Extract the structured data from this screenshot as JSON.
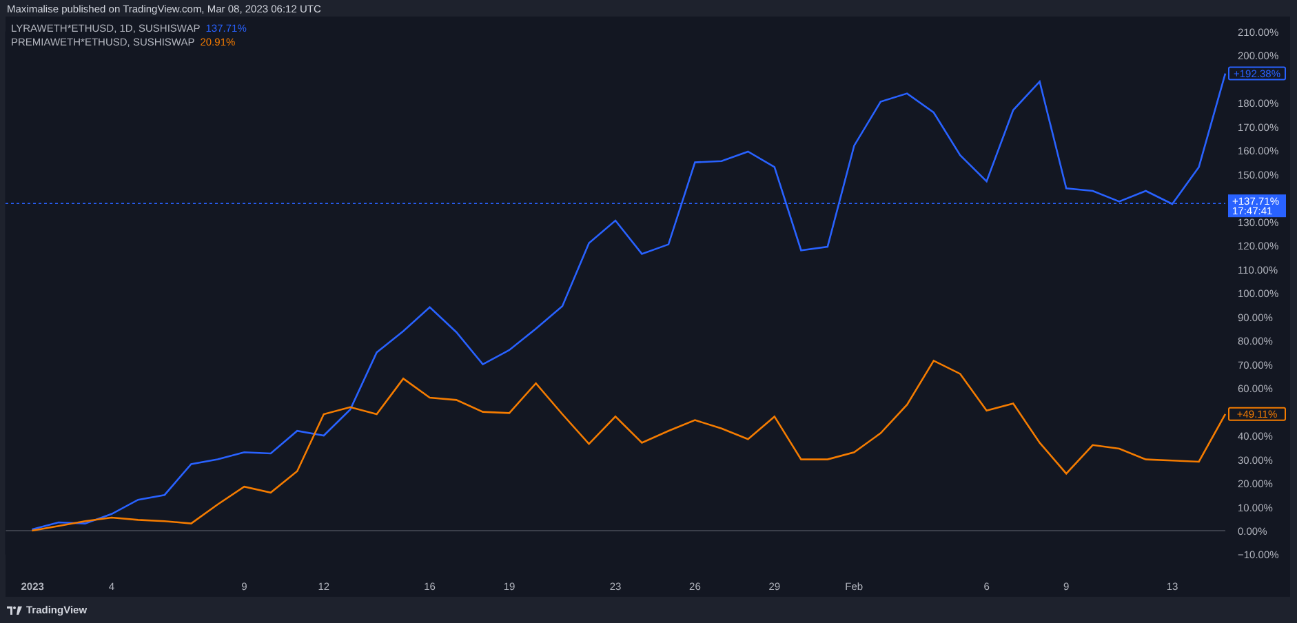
{
  "header": {
    "text": "Maximalise published on TradingView.com, Mar 08, 2023 06:12 UTC"
  },
  "chart": {
    "legend": [
      {
        "value": "137.71%"
      },
      {
        "value": "20.91%"
      }
    ],
    "chart_data": {
      "type": "line",
      "x": [
        "2023-01-01",
        "2023-01-02",
        "2023-01-03",
        "2023-01-04",
        "2023-01-05",
        "2023-01-06",
        "2023-01-07",
        "2023-01-08",
        "2023-01-09",
        "2023-01-10",
        "2023-01-11",
        "2023-01-12",
        "2023-01-13",
        "2023-01-14",
        "2023-01-15",
        "2023-01-16",
        "2023-01-17",
        "2023-01-18",
        "2023-01-19",
        "2023-01-20",
        "2023-01-21",
        "2023-01-22",
        "2023-01-23",
        "2023-01-24",
        "2023-01-25",
        "2023-01-26",
        "2023-01-27",
        "2023-01-28",
        "2023-01-29",
        "2023-01-30",
        "2023-01-31",
        "2023-02-01",
        "2023-02-02",
        "2023-02-03",
        "2023-02-04",
        "2023-02-05",
        "2023-02-06",
        "2023-02-07",
        "2023-02-08",
        "2023-02-09",
        "2023-02-10",
        "2023-02-11",
        "2023-02-12",
        "2023-02-13",
        "2023-02-14",
        "2023-02-15"
      ],
      "series": [
        {
          "name": "LYRAWETH*ETHUSD, 1D, SUSHISWAP",
          "color": "#2962ff",
          "values": [
            0.5,
            3.5,
            3,
            7,
            13,
            15,
            28,
            30,
            33,
            32.5,
            42,
            40,
            51,
            75,
            84,
            94,
            83.5,
            70,
            76,
            85,
            94.5,
            121,
            130.5,
            116.5,
            120.5,
            155,
            155.5,
            159.5,
            153,
            118,
            119.5,
            162,
            180.5,
            184,
            176,
            158,
            147,
            177,
            189,
            144,
            143,
            138.5,
            143,
            137.5,
            153,
            192.4
          ]
        },
        {
          "name": "PREMIAWETH*ETHUSD, SUSHISWAP",
          "color": "#f57c00",
          "values": [
            0,
            2,
            4,
            5.5,
            4.5,
            4,
            3,
            11,
            18.5,
            16,
            25,
            49,
            52,
            49,
            64,
            56,
            55,
            50,
            49.5,
            62,
            49,
            36.5,
            48,
            37,
            42,
            46.5,
            43,
            38.5,
            48,
            30,
            30,
            33,
            41,
            53,
            71.5,
            66,
            50.5,
            53.5,
            37,
            24,
            36,
            34.5,
            30,
            29.5,
            29,
            49.1
          ]
        }
      ],
      "xlim": [
        "2022-12-31",
        "2023-02-15"
      ],
      "ylim": [
        -10,
        210
      ],
      "yticks": [
        {
          "value": -10,
          "label": "−10.00%"
        },
        {
          "value": 0,
          "label": "0.00%"
        },
        {
          "value": 10,
          "label": "10.00%"
        },
        {
          "value": 20,
          "label": "20.00%"
        },
        {
          "value": 30,
          "label": "30.00%"
        },
        {
          "value": 40,
          "label": "40.00%"
        },
        {
          "value": 60,
          "label": "60.00%"
        },
        {
          "value": 70,
          "label": "70.00%"
        },
        {
          "value": 80,
          "label": "80.00%"
        },
        {
          "value": 90,
          "label": "90.00%"
        },
        {
          "value": 100,
          "label": "100.00%"
        },
        {
          "value": 110,
          "label": "110.00%"
        },
        {
          "value": 120,
          "label": "120.00%"
        },
        {
          "value": 130,
          "label": "130.00%"
        },
        {
          "value": 150,
          "label": "150.00%"
        },
        {
          "value": 160,
          "label": "160.00%"
        },
        {
          "value": 170,
          "label": "170.00%"
        },
        {
          "value": 180,
          "label": "180.00%"
        },
        {
          "value": 200,
          "label": "200.00%"
        },
        {
          "value": 210,
          "label": "210.00%"
        }
      ],
      "xticks": [
        {
          "value": "2023-01-01",
          "label": "2023"
        },
        {
          "value": "2023-01-04",
          "label": "4"
        },
        {
          "value": "2023-01-09",
          "label": "9"
        },
        {
          "value": "2023-01-12",
          "label": "12"
        },
        {
          "value": "2023-01-16",
          "label": "16"
        },
        {
          "value": "2023-01-19",
          "label": "19"
        },
        {
          "value": "2023-01-23",
          "label": "23"
        },
        {
          "value": "2023-01-26",
          "label": "26"
        },
        {
          "value": "2023-01-29",
          "label": "29"
        },
        {
          "value": "2023-02-01",
          "label": "Feb"
        },
        {
          "value": "2023-02-06",
          "label": "6"
        },
        {
          "value": "2023-02-09",
          "label": "9"
        },
        {
          "value": "2023-02-13",
          "label": "13"
        }
      ],
      "ref_lines": [
        {
          "axis": "y",
          "value": 137.71,
          "color": "#2962ff"
        }
      ]
    },
    "price_labels": [
      {
        "label": "+192.38%"
      },
      {
        "label": "+49.11%"
      }
    ],
    "crosshair": {
      "label": "+137.71%",
      "time": "17:47:41"
    }
  },
  "footer": {
    "logo": "TradingView"
  }
}
